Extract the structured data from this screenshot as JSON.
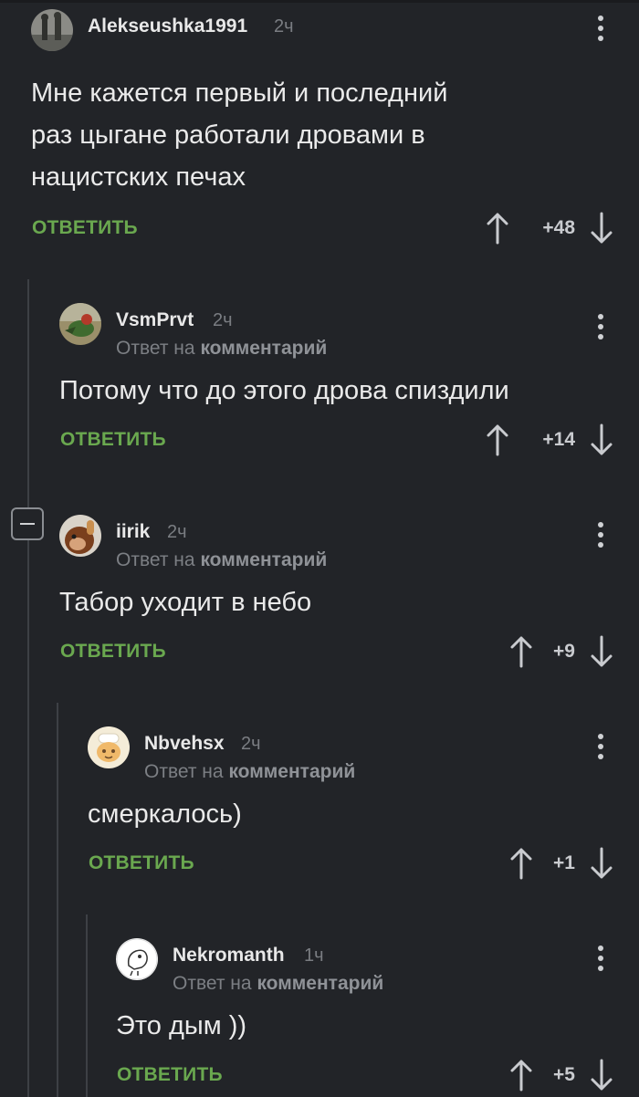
{
  "comments": [
    {
      "user": "Alekseushka1991",
      "time": "2ч",
      "text_lines": [
        "Мне кажется первый и последний",
        "раз цыгане работали дровами в",
        "нацистских печах"
      ],
      "reply_label": "ОТВЕТИТЬ",
      "score": "+48"
    },
    {
      "user": "VsmPrvt",
      "time": "2ч",
      "reply_prefix": "Ответ на",
      "reply_target": "комментарий",
      "text_lines": [
        "Потому что до этого дрова спиздили"
      ],
      "reply_label": "ОТВЕТИТЬ",
      "score": "+14"
    },
    {
      "user": "iirik",
      "time": "2ч",
      "reply_prefix": "Ответ на",
      "reply_target": "комментарий",
      "text_lines": [
        "Табор уходит в небо"
      ],
      "reply_label": "ОТВЕТИТЬ",
      "score": "+9"
    },
    {
      "user": "Nbvehsx",
      "time": "2ч",
      "reply_prefix": "Ответ на",
      "reply_target": "комментарий",
      "text_lines": [
        "смеркалось)"
      ],
      "reply_label": "ОТВЕТИТЬ",
      "score": "+1"
    },
    {
      "user": "Nekromanth",
      "time": "1ч",
      "reply_prefix": "Ответ на",
      "reply_target": "комментарий",
      "text_lines": [
        "Это дым ))"
      ],
      "reply_label": "ОТВЕТИТЬ",
      "score": "+5"
    }
  ],
  "icons": {
    "menu": "more-vertical-icon",
    "upvote": "arrow-up-icon",
    "downvote": "arrow-down-icon",
    "collapse": "minus-icon"
  },
  "colors": {
    "background": "#222428",
    "accent_reply": "#6aa84f",
    "thread_line": "#3d4045",
    "muted_text": "#7c7f84"
  }
}
